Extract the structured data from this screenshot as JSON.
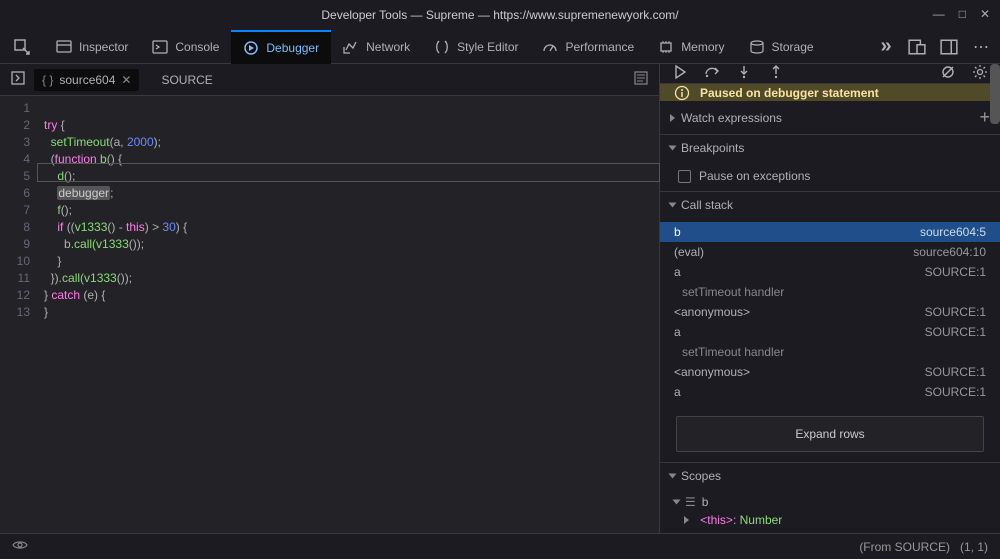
{
  "window": {
    "title": "Developer Tools — Supreme — https://www.supremenewyork.com/"
  },
  "tabs": {
    "inspector": "Inspector",
    "console": "Console",
    "debugger": "Debugger",
    "network": "Network",
    "style": "Style Editor",
    "performance": "Performance",
    "memory": "Memory",
    "storage": "Storage"
  },
  "source": {
    "file_tab": "source604",
    "breadcrumb": "SOURCE",
    "lines": [
      "1",
      "2",
      "3",
      "4",
      "5",
      "6",
      "7",
      "8",
      "9",
      "10",
      "11",
      "12",
      "13"
    ],
    "highlight_line": 5
  },
  "code_tokens": {
    "l1_try": "try",
    "l1_brace": " {",
    "l2_fn": "setTimeout",
    "l2_rest": "(a, ",
    "l2_num": "2000",
    "l2_end": ");",
    "l3_open": "(",
    "l3_kw": "function ",
    "l3_name": "b",
    "l3_rest": "() {",
    "l4_call": "d",
    "l4_end": "();",
    "l5_kw": "debugger",
    "l5_end": ";",
    "l6_call": "f",
    "l6_end": "();",
    "l7_if": "if ",
    "l7_open": "((",
    "l7_v": "v1333",
    "l7_mid": "() - ",
    "l7_this": "this",
    "l7_close": ") > ",
    "l7_num": "30",
    "l7_end": ") {",
    "l8_b": "b",
    "l8_call": ".call(",
    "l8_v": "v1333",
    "l8_end": "());",
    "l9": "}",
    "l10_close": "}).",
    "l10_call": "call",
    "l10_open": "(",
    "l10_v": "v1333",
    "l10_end": "());",
    "l11_brace": "} ",
    "l11_catch": "catch ",
    "l11_rest": "(e) {",
    "l12": "}"
  },
  "paused_banner": "Paused on debugger statement",
  "sections": {
    "watch": "Watch expressions",
    "breakpoints": "Breakpoints",
    "pause_exc": "Pause on exceptions",
    "callstack": "Call stack",
    "scopes": "Scopes"
  },
  "callstack": [
    {
      "name": "b",
      "loc": "source604:5",
      "sel": true
    },
    {
      "name": "(eval)",
      "loc": "source604:10"
    },
    {
      "name": "a",
      "loc": "SOURCE:1"
    },
    {
      "gap": "setTimeout handler"
    },
    {
      "name": "<anonymous>",
      "loc": "SOURCE:1"
    },
    {
      "name": "a",
      "loc": "SOURCE:1"
    },
    {
      "gap": "setTimeout handler"
    },
    {
      "name": "<anonymous>",
      "loc": "SOURCE:1"
    },
    {
      "name": "a",
      "loc": "SOURCE:1"
    }
  ],
  "expand_rows": "Expand rows",
  "scope_block": "b",
  "scope_item": {
    "key": "<this>",
    "sep": ": ",
    "val": "Number"
  },
  "footer": {
    "from": "(From SOURCE)",
    "pos": "(1, 1)"
  }
}
